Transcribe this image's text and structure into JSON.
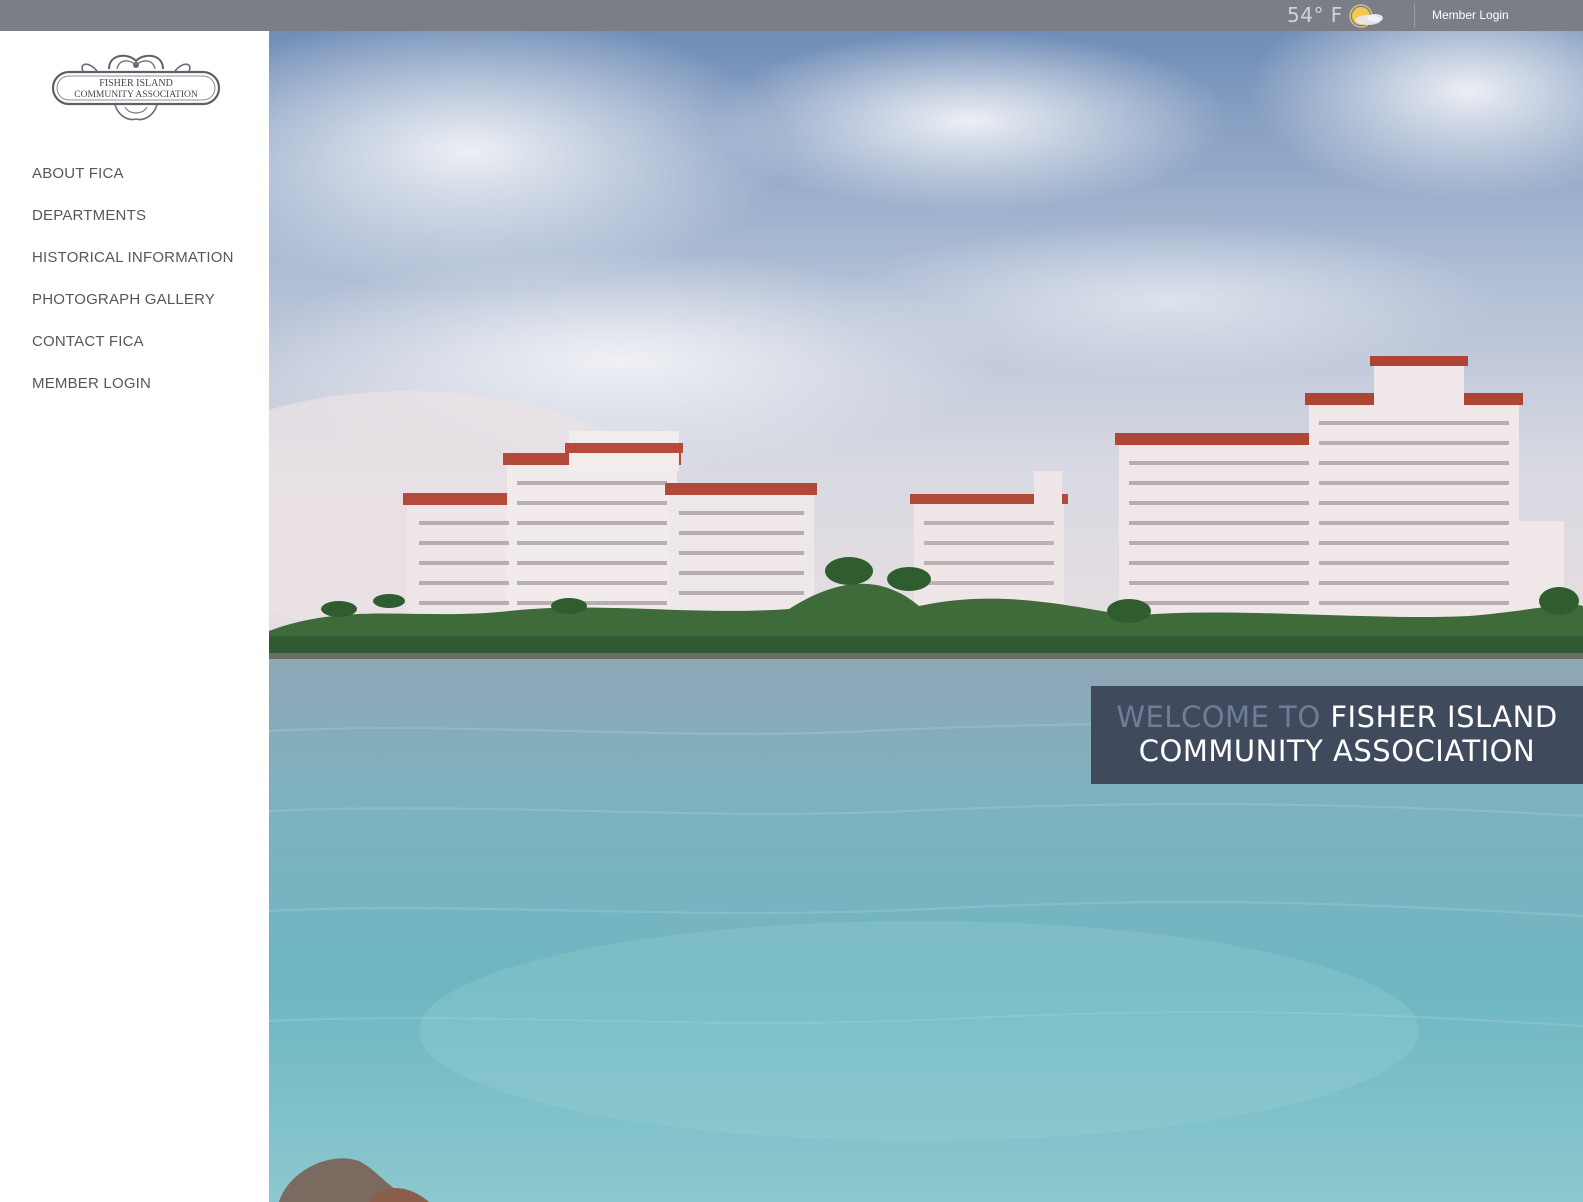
{
  "topbar": {
    "temperature": "54° F",
    "weather_icon": "partly-sunny-icon",
    "member_login": "Member Login"
  },
  "logo": {
    "line1": "FISHER ISLAND",
    "line2": "COMMUNITY ASSOCIATION"
  },
  "nav": {
    "items": [
      {
        "label": "ABOUT FICA"
      },
      {
        "label": "DEPARTMENTS"
      },
      {
        "label": "HISTORICAL INFORMATION"
      },
      {
        "label": "PHOTOGRAPH GALLERY"
      },
      {
        "label": "CONTACT FICA"
      },
      {
        "label": "MEMBER LOGIN"
      }
    ]
  },
  "hero": {
    "welcome_prefix": "WELCOME TO",
    "welcome_name": "FISHER ISLAND",
    "welcome_line2": "COMMUNITY ASSOCIATION"
  },
  "colors": {
    "topbar": "#7b7d87",
    "welcome_box": "#3f4a5c",
    "nav_text": "#55575f"
  }
}
